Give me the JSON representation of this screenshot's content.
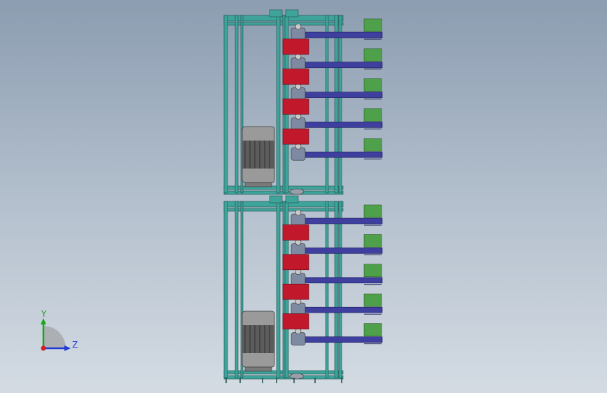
{
  "viewport": {
    "background_top": "#8c9db1",
    "background_bottom": "#d4dbe3"
  },
  "model": {
    "frame_color": "#3ea39a",
    "frame_edge_color": "#1f4f4b",
    "motor_color": "#9a9a9a",
    "red_block_color": "#c2182c",
    "arm_color": "#3e3f9e",
    "green_block_color": "#4fa04a",
    "modules": 2,
    "red_blocks_per_module": 4,
    "arms_per_module": 5
  },
  "triad": {
    "y_label": "Y",
    "z_label": "Z",
    "y_color": "#1aa51a",
    "z_color": "#1f3bd1",
    "x_color": "#d11f1f",
    "icon": "view-orientation-triad-icon"
  }
}
